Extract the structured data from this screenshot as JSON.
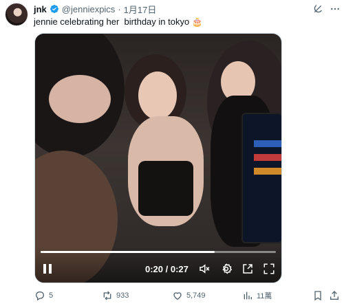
{
  "post": {
    "display_name": "jnk",
    "handle": "@jenniexpics",
    "separator": "·",
    "date": "1月17日",
    "text": "jennie celebrating her  birthday in tokyo ",
    "emoji": "🎂"
  },
  "video": {
    "time": "0:20 / 0:27",
    "progress_fraction": 0.74
  },
  "actions": {
    "replies": "5",
    "reposts": "933",
    "likes": "5,749",
    "views": "11萬"
  },
  "icons": [
    "verified-icon",
    "grok-icon",
    "more-icon",
    "pause-icon",
    "volume-muted-icon",
    "settings-gear-icon",
    "picture-in-picture-icon",
    "fullscreen-icon",
    "reply-icon",
    "repost-icon",
    "like-heart-icon",
    "views-chart-icon",
    "bookmark-icon",
    "share-icon"
  ],
  "colors": {
    "verified": "#1d9bf0",
    "secondary_text": "#536471"
  }
}
